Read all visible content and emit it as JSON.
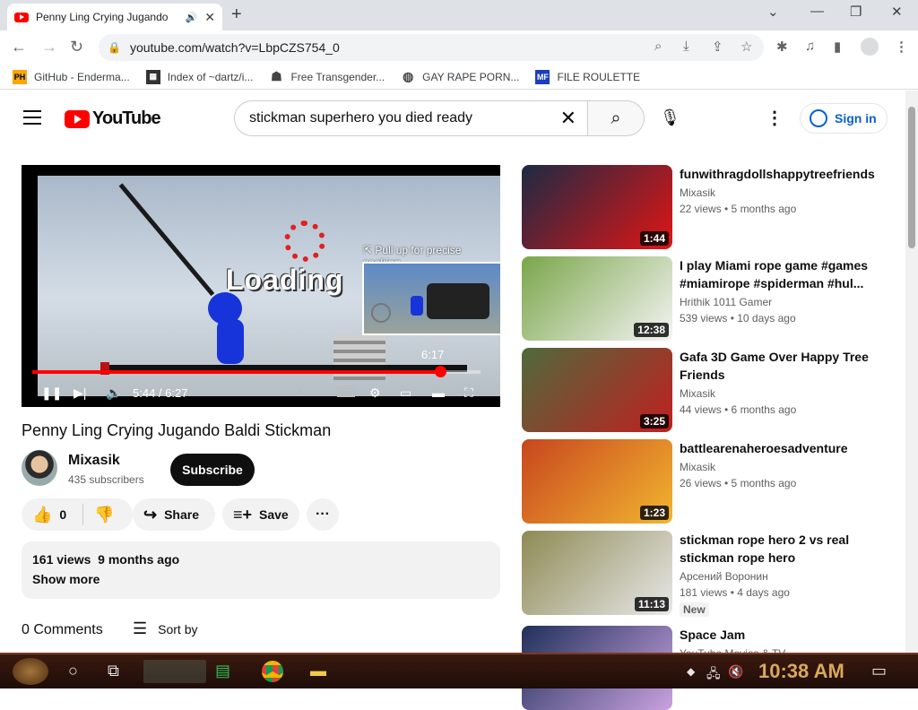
{
  "browser": {
    "tab_title": "Penny Ling Crying Jugando",
    "url": "youtube.com/watch?v=LbpCZS754_0",
    "bookmarks": [
      {
        "label": "GitHub - Enderma...",
        "icon": "PH",
        "color": "#f7a707"
      },
      {
        "label": "Index of ~dartz/i...",
        "icon": "▦",
        "color": "#333333"
      },
      {
        "label": "Free Transgender...",
        "icon": "☗",
        "color": "#555555"
      },
      {
        "label": "GAY RAPE PORN...",
        "icon": "◍",
        "color": "#555555"
      },
      {
        "label": "FILE ROULETTE",
        "icon": "MF",
        "color": "#1a3cc1"
      }
    ]
  },
  "youtube": {
    "logo_text": "YouTube",
    "search_query": "stickman superhero you died ready",
    "sign_in": "Sign in"
  },
  "player": {
    "overlay_text": "Loading",
    "seek_hint": "⇱ Pull up for precise seeking",
    "preview_time": "6:17",
    "time": "5:44 / 6:27",
    "progress": 0.91
  },
  "video": {
    "title": "Penny Ling Crying Jugando Baldi Stickman",
    "channel": "Mixasik",
    "subscribers": "435 subscribers",
    "subscribe": "Subscribe",
    "likes": "0",
    "share": "Share",
    "save": "Save",
    "views": "161 views",
    "age": "9 months ago",
    "show_more": "Show more",
    "comments": "0 Comments",
    "sort_by": "Sort by"
  },
  "related": [
    {
      "title": "funwithragdollshappytreefriends",
      "channel": "Mixasik",
      "meta": "22 views • 5 months ago",
      "duration": "1:44",
      "bg": "#1c2a44",
      "accent": "#e01515"
    },
    {
      "title": "I play Miami rope game #games #miamirope #spiderman #hul...",
      "channel": "Hrithik 1011 Gamer",
      "meta": "539 views • 10 days ago",
      "duration": "12:38",
      "bg": "#7aa64a",
      "accent": "#f4f4f4"
    },
    {
      "title": "Gafa 3D Game Over Happy Tree Friends",
      "channel": "Mixasik",
      "meta": "44 views • 6 months ago",
      "duration": "3:25",
      "bg": "#4f6a3c",
      "accent": "#c02020"
    },
    {
      "title": "battlearenaheroesadventure",
      "channel": "Mixasik",
      "meta": "26 views • 5 months ago",
      "duration": "1:23",
      "bg": "#c8461e",
      "accent": "#f2b530"
    },
    {
      "title": "stickman rope hero 2 vs real stickman rope hero",
      "channel": "Арсений Воронин",
      "meta": "181 views • 4 days ago",
      "duration": "11:13",
      "bg": "#8e8a55",
      "accent": "#e8e8e8",
      "badge": "New"
    },
    {
      "title": "Space Jam",
      "channel": "YouTube Movies & TV",
      "meta": "",
      "duration": "",
      "bg": "#20305a",
      "accent": "#c9a2e0"
    }
  ],
  "taskbar": {
    "clock": "10:38 AM"
  }
}
